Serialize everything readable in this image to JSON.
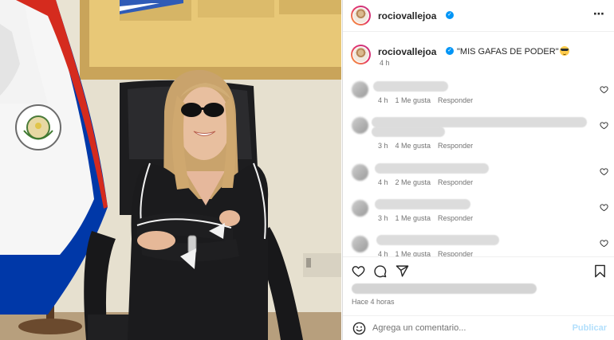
{
  "header": {
    "username": "rociovallejoa",
    "verified_badge": "✓",
    "more_icon": "⋯"
  },
  "caption": {
    "username": "rociovallejoa",
    "verified_badge": "✓",
    "text": "\"MIS GAFAS DE PODER\"",
    "emoji": "sunglasses-emoji",
    "time": "4 h"
  },
  "comments": [
    {
      "time": "4 h",
      "likes": "1 Me gusta",
      "reply": "Responder"
    },
    {
      "time": "3 h",
      "likes": "4 Me gusta",
      "reply": "Responder"
    },
    {
      "time": "4 h",
      "likes": "2 Me gusta",
      "reply": "Responder"
    },
    {
      "time": "3 h",
      "likes": "1 Me gusta",
      "reply": "Responder"
    },
    {
      "time": "4 h",
      "likes": "1 Me gusta",
      "reply": "Responder"
    }
  ],
  "actions": {
    "like_icon": "heart-icon",
    "comment_icon": "comment-icon",
    "share_icon": "share-icon",
    "save_icon": "bookmark-icon"
  },
  "post_time": "Hace 4 horas",
  "add_comment": {
    "placeholder": "Agrega un comentario...",
    "post_label": "Publicar"
  },
  "colors": {
    "link_blue": "#0095f6",
    "post_disabled": "#b2dffc",
    "meta_gray": "#737373",
    "flag_red": "#d52b1e",
    "flag_blue": "#0038a8"
  }
}
